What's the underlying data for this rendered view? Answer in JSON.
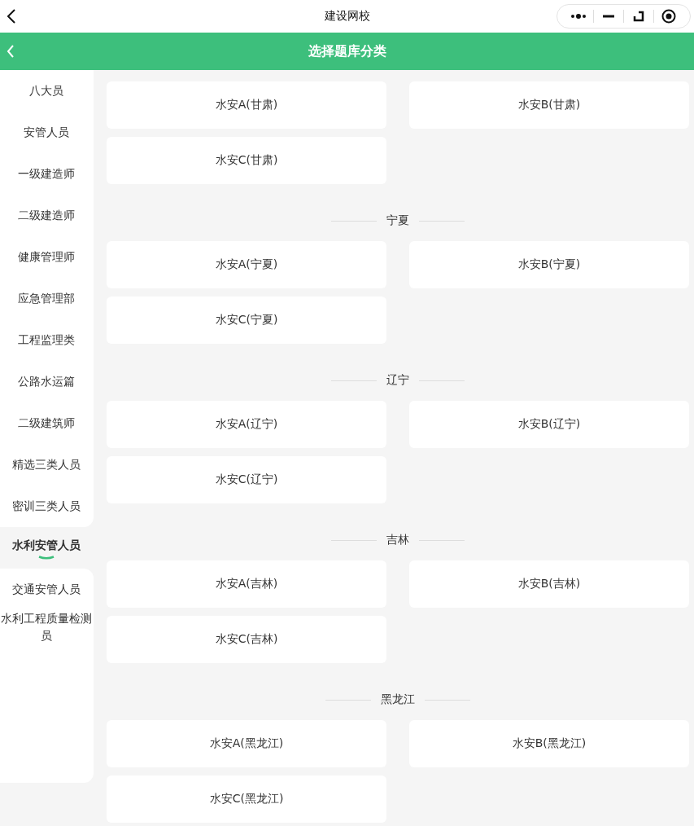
{
  "top_bar": {
    "title": "建设网校"
  },
  "header": {
    "title": "选择题库分类"
  },
  "sidebar": {
    "items": [
      {
        "label": "八大员",
        "selected": false
      },
      {
        "label": "安管人员",
        "selected": false
      },
      {
        "label": "一级建造师",
        "selected": false
      },
      {
        "label": "二级建造师",
        "selected": false
      },
      {
        "label": "健康管理师",
        "selected": false
      },
      {
        "label": "应急管理部",
        "selected": false
      },
      {
        "label": "工程监理类",
        "selected": false
      },
      {
        "label": "公路水运篇",
        "selected": false
      },
      {
        "label": "二级建筑师",
        "selected": false
      },
      {
        "label": "精选三类人员",
        "selected": false
      },
      {
        "label": "密训三类人员",
        "selected": false
      },
      {
        "label": "水利安管人员",
        "selected": true
      },
      {
        "label": "交通安管人员",
        "selected": false
      },
      {
        "label": "水利工程质量检测员",
        "selected": false
      }
    ]
  },
  "sections": [
    {
      "cards": [
        "水安A(甘肃)",
        "水安B(甘肃)",
        "水安C(甘肃)"
      ]
    },
    {
      "title": "宁夏",
      "cards": [
        "水安A(宁夏)",
        "水安B(宁夏)",
        "水安C(宁夏)"
      ]
    },
    {
      "title": "辽宁",
      "cards": [
        "水安A(辽宁)",
        "水安B(辽宁)",
        "水安C(辽宁)"
      ]
    },
    {
      "title": "吉林",
      "cards": [
        "水安A(吉林)",
        "水安B(吉林)",
        "水安C(吉林)"
      ]
    },
    {
      "title": "黑龙江",
      "cards": [
        "水安A(黑龙江)",
        "水安B(黑龙江)",
        "水安C(黑龙江)"
      ]
    }
  ]
}
